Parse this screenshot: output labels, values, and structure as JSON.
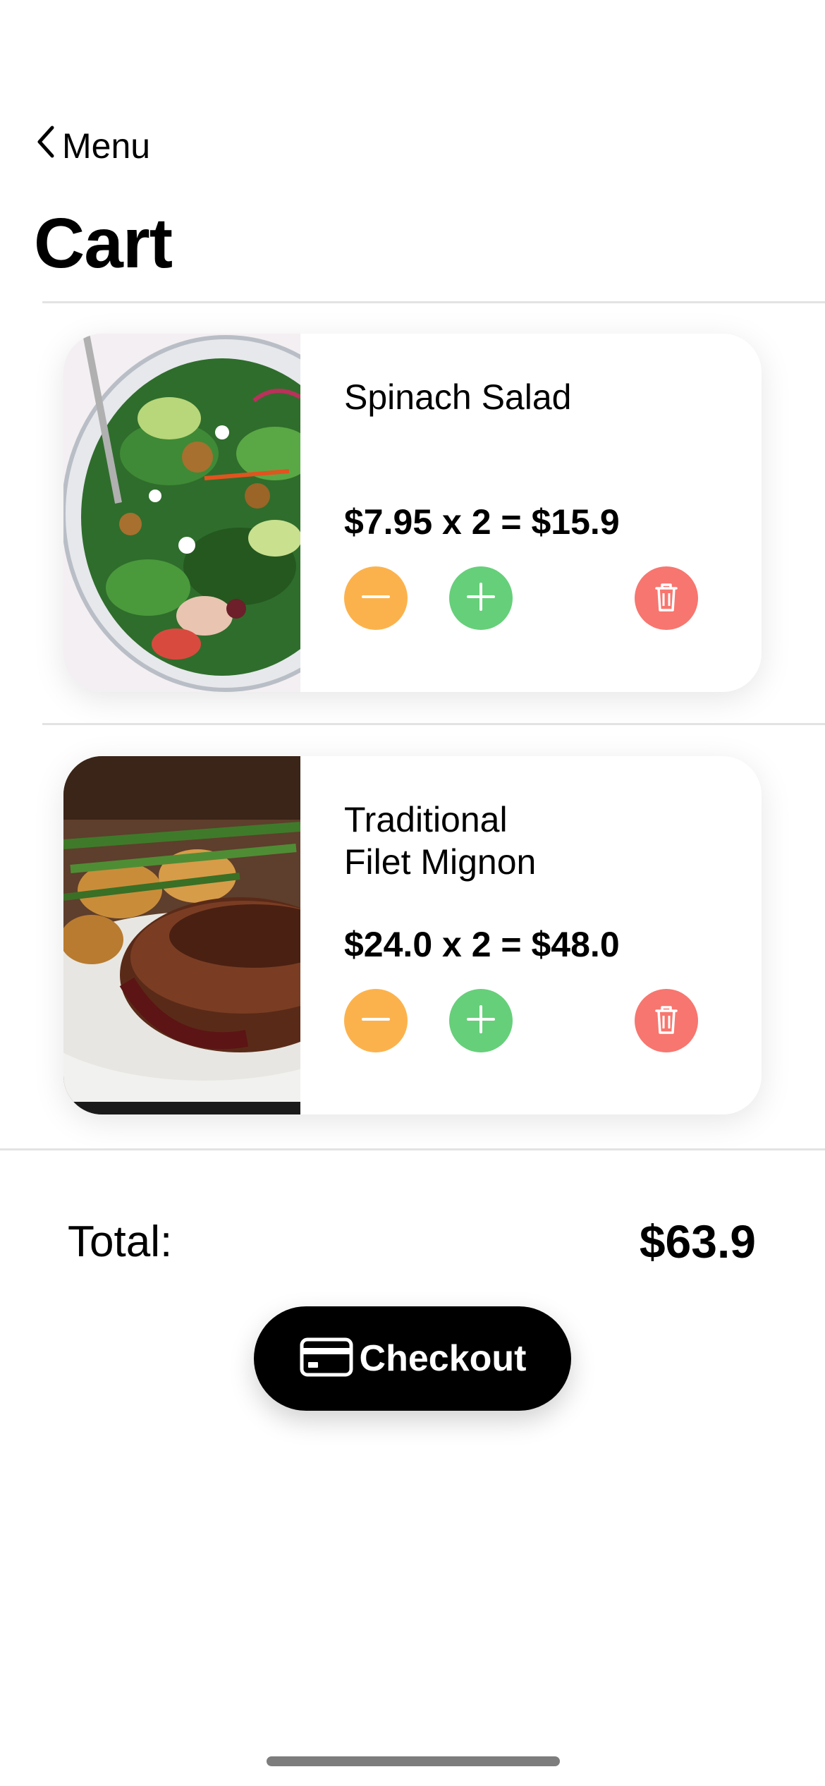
{
  "nav": {
    "back_label": "Menu",
    "title": "Cart"
  },
  "cart": {
    "items": [
      {
        "name": "Spinach Salad",
        "price_line": "$7.95 x 2 = $15.9",
        "image": "spinach-salad-photo"
      },
      {
        "name": "Traditional\nFilet Mignon",
        "price_line": "$24.0 x 2 = $48.0",
        "image": "filet-mignon-photo"
      }
    ]
  },
  "summary": {
    "total_label": "Total:",
    "total_value": "$63.9"
  },
  "checkout": {
    "label": "Checkout",
    "icon": "credit-card-icon"
  },
  "colors": {
    "minus_button": "#fcb24c",
    "plus_button": "#66cf7a",
    "delete_button": "#f7766f",
    "checkout_background": "#000000"
  },
  "icons": {
    "back": "chevron-left-icon",
    "decrease": "minus-icon",
    "increase": "plus-icon",
    "remove": "trash-icon"
  }
}
